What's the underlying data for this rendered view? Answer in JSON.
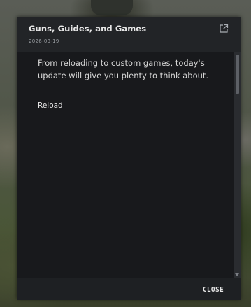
{
  "dialog": {
    "title": "Guns, Guides, and Games",
    "date": "2026-03-19",
    "external_link_icon": "external-link-icon",
    "body_text": "From reloading to custom games, today's update will give you plenty to think about.",
    "section_label": "Reload",
    "close_label": "CLOSE"
  },
  "colors": {
    "dialog_bg": "#18191c",
    "header_bg": "#222427",
    "footer_bg": "#1e2023",
    "text": "#d7d7d7"
  }
}
